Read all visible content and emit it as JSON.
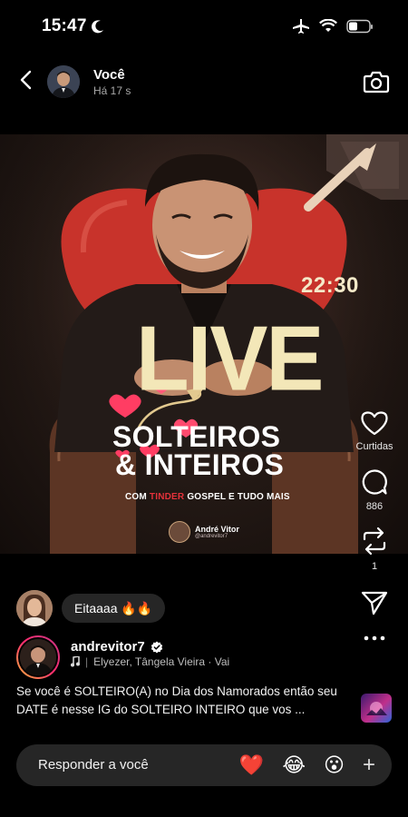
{
  "status_bar": {
    "time": "15:47"
  },
  "header": {
    "name": "Você",
    "time": "Há 17 s"
  },
  "poster": {
    "time": "22:30",
    "title": "LIVE",
    "line1": "SOLTEIROS",
    "line2": "& INTEIROS",
    "sub_pre": "COM ",
    "sub_accent": "TINDER",
    "sub_post": " GOSPEL E TUDO MAIS",
    "badge_name": "André Vitor",
    "badge_handle": "@andrevitor7"
  },
  "rail": {
    "like_label": "Curtidas",
    "comments_count": "886",
    "reposts_count": "1"
  },
  "comment": {
    "text": "Eitaaaa 🔥🔥"
  },
  "author": {
    "username": "andrevitor7",
    "music": "Elyezer, Tângela Vieira · Vai"
  },
  "caption": "Se você é SOLTEIRO(A) no Dia dos Namorados então seu DATE é nesse IG do SOLTEIRO INTEIRO que vos ...",
  "reply": {
    "placeholder": "Responder a você",
    "emojis": [
      "❤️",
      "😂",
      "😮"
    ],
    "plus": "+"
  },
  "colors": {
    "accent_red": "#e4323b",
    "poster_cream": "#f3e7b8",
    "verified_blue": "#3897f0"
  }
}
